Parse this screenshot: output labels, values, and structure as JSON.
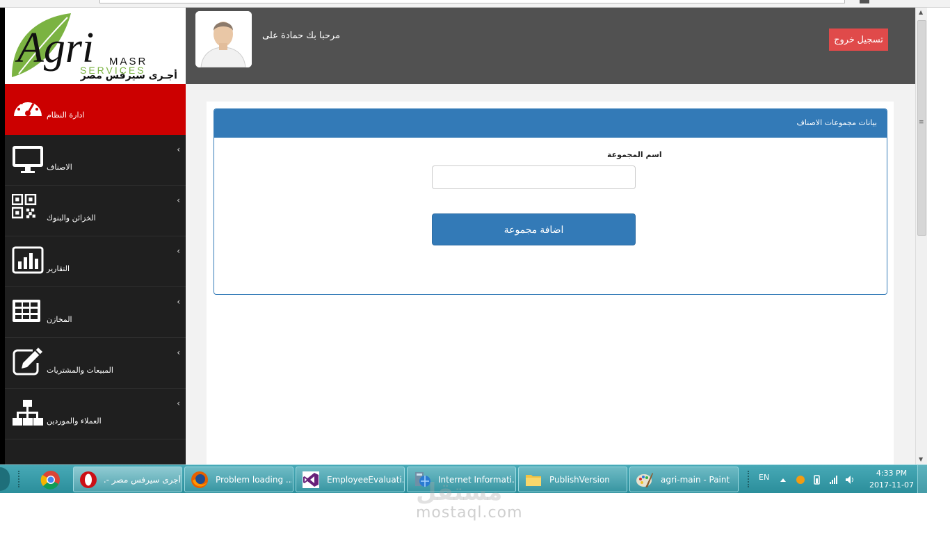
{
  "brand": {
    "logo_text": "Agri",
    "logo_sub1": "MASR",
    "logo_sub2": "SERVICES",
    "logo_arabic": "أجـرى سيرفس مصر"
  },
  "header": {
    "welcome": "مرحبا بك حمادة على",
    "logout_label": "تسجيل خروج",
    "logout_color": "#e04a4a"
  },
  "sidebar": {
    "active_color": "#cc0000",
    "items": [
      {
        "label": "ادارة النظام",
        "icon": "dashboard-gauge-icon"
      },
      {
        "label": "الاصناف",
        "icon": "monitor-icon"
      },
      {
        "label": "الخزائن والبنوك",
        "icon": "qr-code-icon"
      },
      {
        "label": "التقارير",
        "icon": "bar-chart-icon"
      },
      {
        "label": "المخازن",
        "icon": "grid-table-icon"
      },
      {
        "label": "المبيعات والمشتريات",
        "icon": "edit-icon"
      },
      {
        "label": "العملاء والموردين",
        "icon": "sitemap-icon"
      }
    ]
  },
  "panel": {
    "title": "بيانات مجموعات الاصناف",
    "accent": "#337ab7",
    "field_label": "اسم المجموعة",
    "field_value": "",
    "field_placeholder": "",
    "submit_label": "اضافة مجموعة"
  },
  "taskbar": {
    "buttons": [
      {
        "label": "أجرى سيرفس مصر -...",
        "icon": "opera-icon"
      },
      {
        "label": "Problem loading ...",
        "icon": "firefox-icon"
      },
      {
        "label": "EmployeeEvaluati...",
        "icon": "visual-studio-icon"
      },
      {
        "label": "Internet Informati...",
        "icon": "iis-manager-icon"
      },
      {
        "label": "PublishVersion",
        "icon": "folder-icon"
      },
      {
        "label": "agri-main - Paint",
        "icon": "paint-icon"
      }
    ],
    "lang": "EN",
    "time": "4:33 PM",
    "date": "2017-11-07"
  },
  "watermark": {
    "text": "mostaql.com",
    "arabic": "مستقل"
  }
}
